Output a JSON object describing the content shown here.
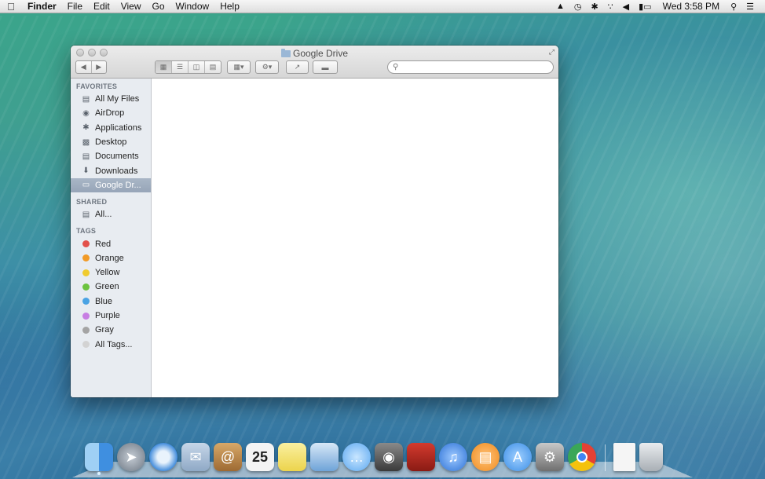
{
  "menubar": {
    "items": [
      "Finder",
      "File",
      "Edit",
      "View",
      "Go",
      "Window",
      "Help"
    ],
    "clock": "Wed 3:58 PM"
  },
  "window": {
    "title": "Google Drive",
    "search_placeholder": ""
  },
  "sidebar": {
    "favorites_header": "FAVORITES",
    "favorites": [
      {
        "label": "All My Files",
        "icon": "all-my-files-icon"
      },
      {
        "label": "AirDrop",
        "icon": "airdrop-icon"
      },
      {
        "label": "Applications",
        "icon": "applications-icon"
      },
      {
        "label": "Desktop",
        "icon": "desktop-icon"
      },
      {
        "label": "Documents",
        "icon": "documents-icon"
      },
      {
        "label": "Downloads",
        "icon": "downloads-icon"
      },
      {
        "label": "Google Dr...",
        "icon": "folder-icon",
        "selected": true
      }
    ],
    "shared_header": "SHARED",
    "shared": [
      {
        "label": "All...",
        "icon": "network-icon"
      }
    ],
    "tags_header": "TAGS",
    "tags": [
      {
        "label": "Red",
        "color": "#e2504a"
      },
      {
        "label": "Orange",
        "color": "#f19a26"
      },
      {
        "label": "Yellow",
        "color": "#f0cb2e"
      },
      {
        "label": "Green",
        "color": "#6cc33f"
      },
      {
        "label": "Blue",
        "color": "#4aa3e4"
      },
      {
        "label": "Purple",
        "color": "#c77ee3"
      },
      {
        "label": "Gray",
        "color": "#a4a4a4"
      },
      {
        "label": "All Tags...",
        "color": "#d3d3d3"
      }
    ]
  },
  "dock": {
    "apps": [
      {
        "name": "finder",
        "color": "#3f8fe0"
      },
      {
        "name": "launchpad",
        "color": "#7d8794"
      },
      {
        "name": "safari",
        "color": "#2d7fd8"
      },
      {
        "name": "mail",
        "color": "#8fa9c6"
      },
      {
        "name": "contacts",
        "color": "#b98548"
      },
      {
        "name": "calendar",
        "color": "#f4f4f4",
        "label": "25"
      },
      {
        "name": "notes",
        "color": "#f3e05a"
      },
      {
        "name": "preview",
        "color": "#6ea3d8"
      },
      {
        "name": "messages",
        "color": "#5aa7f0"
      },
      {
        "name": "facetime",
        "color": "#4b4b4b"
      },
      {
        "name": "photo-booth",
        "color": "#b12a21"
      },
      {
        "name": "itunes",
        "color": "#2d72d6"
      },
      {
        "name": "ibooks",
        "color": "#f08b1d"
      },
      {
        "name": "app-store",
        "color": "#3b8ee6"
      },
      {
        "name": "system-preferences",
        "color": "#8c8c8c"
      },
      {
        "name": "chrome",
        "color": "#e44134"
      }
    ],
    "stack": [
      {
        "name": "document-stack",
        "color": "#f5f5f5"
      },
      {
        "name": "trash",
        "color": "#d0d4d8"
      }
    ]
  }
}
